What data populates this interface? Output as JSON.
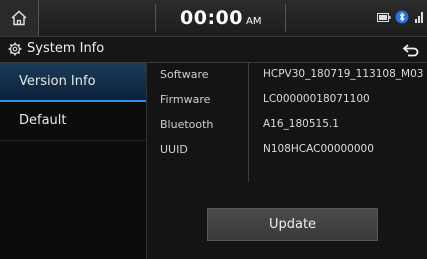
{
  "status_bar": {
    "time": "00:00",
    "ampm": "AM",
    "icons": [
      "home-icon",
      "battery-icon",
      "bluetooth-icon",
      "signal-icon"
    ]
  },
  "titlebar": {
    "title": "System Info",
    "icon": "gear-icon",
    "back_icon": "back-arrow-icon"
  },
  "sidebar": {
    "items": [
      {
        "label": "Version Info",
        "active": true
      },
      {
        "label": "Default",
        "active": false
      }
    ]
  },
  "info": {
    "rows": [
      {
        "label": "Software",
        "value": "HCPV30_180719_113108_M03"
      },
      {
        "label": "Firmware",
        "value": "LC00000018071100"
      },
      {
        "label": "Bluetooth",
        "value": "A16_180515.1"
      },
      {
        "label": "UUID",
        "value": "N108HCAC00000000"
      }
    ]
  },
  "update_button": {
    "label": "Update"
  },
  "colors": {
    "accent": "#2f8fe6",
    "active_bg": "#1a3c5c",
    "background": "#101010"
  }
}
